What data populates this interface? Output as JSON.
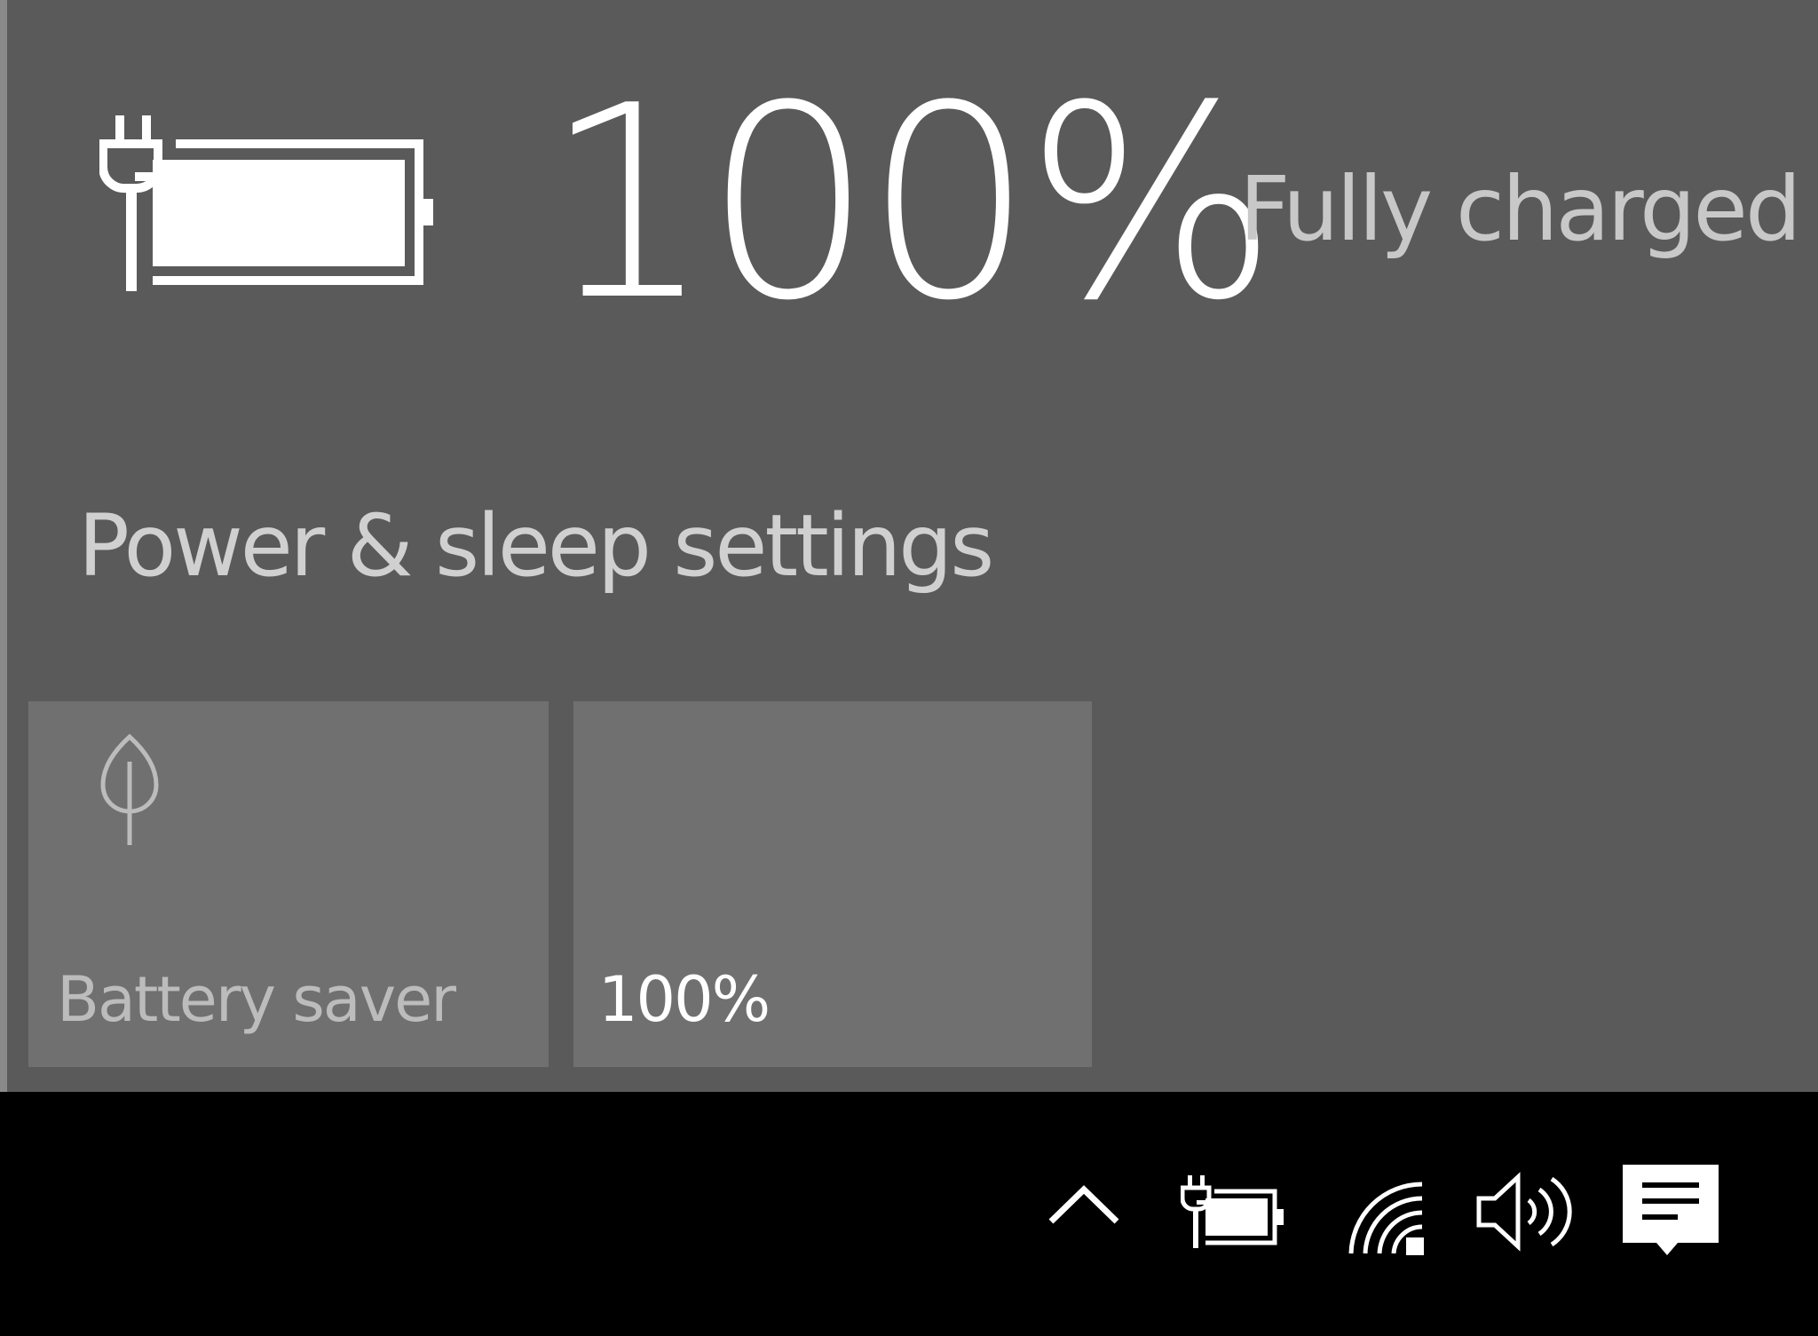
{
  "battery": {
    "percent_label": "100%",
    "status": "Fully charged",
    "level": 1.0,
    "plugged_in": true,
    "icon": "battery-charging-icon"
  },
  "settings_link": {
    "label": "Power & sleep settings"
  },
  "quick_actions": [
    {
      "label": "Battery saver",
      "icon": "leaf-icon",
      "state": "disabled"
    },
    {
      "label": "100%",
      "icon": "brightness-icon",
      "state": "normal"
    }
  ],
  "taskbar": {
    "tray_icons": [
      "show-hidden-icons-chevron-icon",
      "battery-charging-icon",
      "wifi-icon",
      "volume-icon",
      "action-center-icon"
    ]
  },
  "colors": {
    "flyout_bg": "#5a5a5a",
    "tile_bg": "#707070",
    "taskbar_bg": "#000000",
    "text_primary": "#ffffff",
    "text_secondary": "#c8c8c8"
  }
}
